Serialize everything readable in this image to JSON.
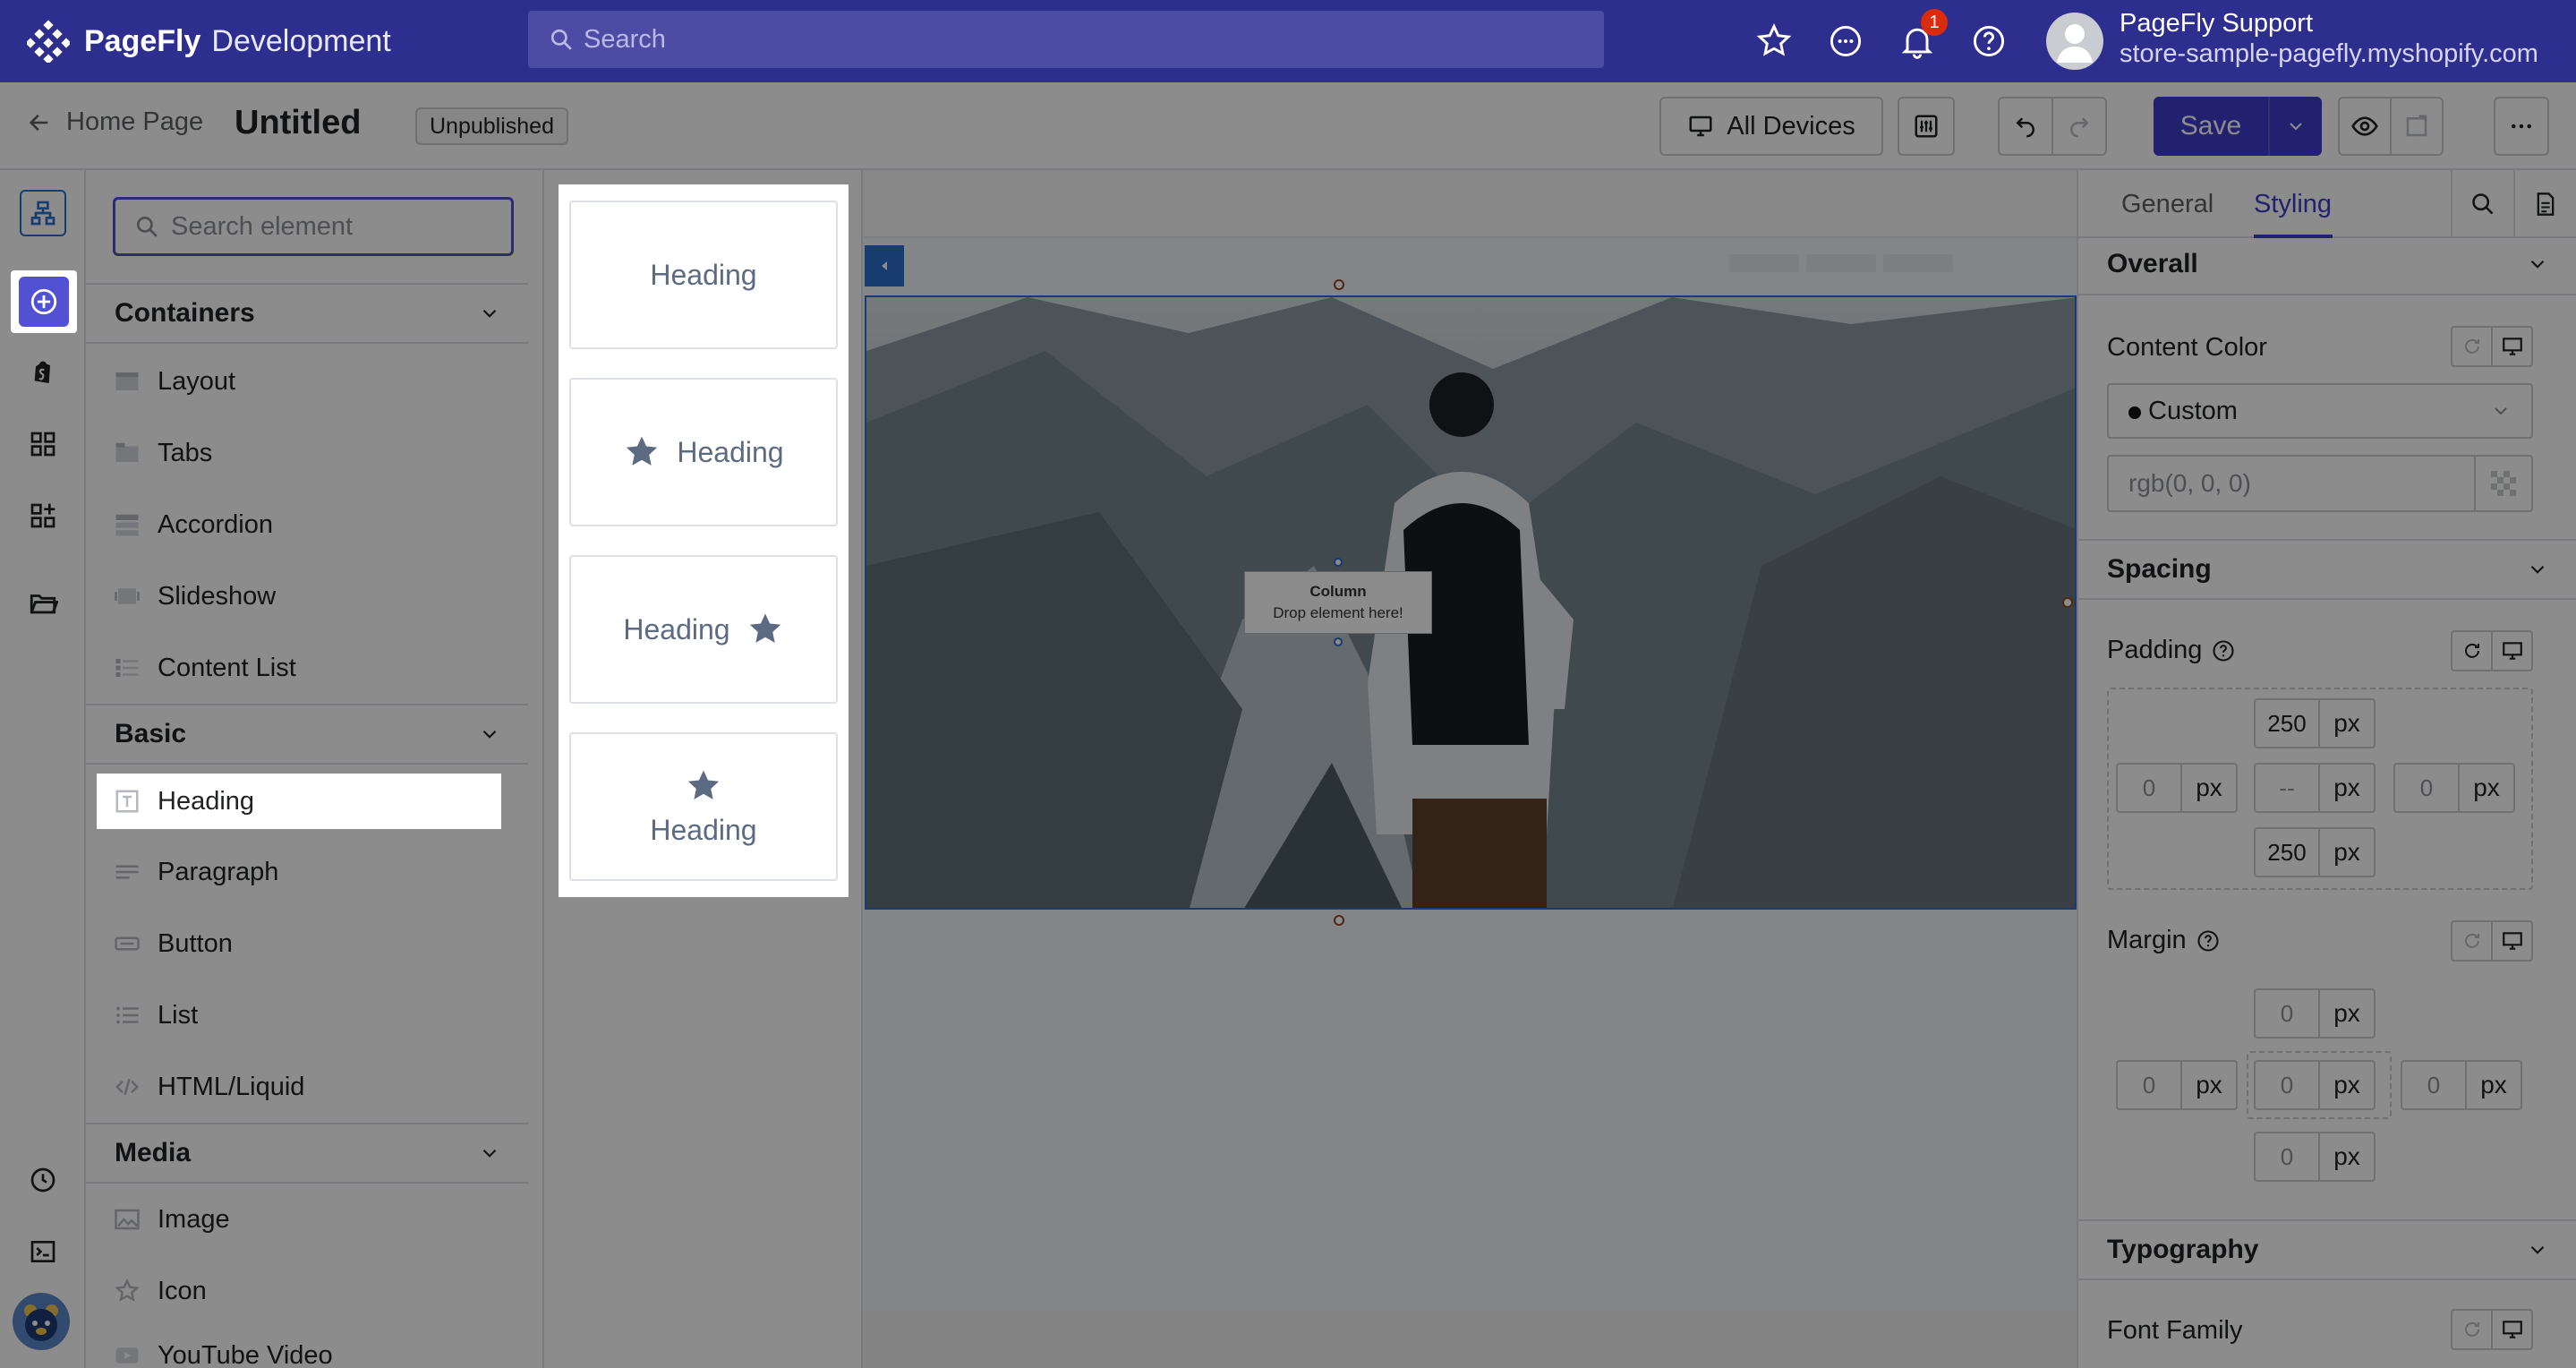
{
  "topbar": {
    "brand_name": "PageFly",
    "brand_sub": "Development",
    "search_placeholder": "Search",
    "notification_count": "1",
    "user_name": "PageFly Support",
    "user_store": "store-sample-pagefly.myshopify.com"
  },
  "header": {
    "back_label": "Home Page",
    "page_title": "Untitled",
    "status_badge": "Unpublished",
    "devices_label": "All Devices",
    "save_label": "Save"
  },
  "element_panel": {
    "search_placeholder": "Search element",
    "sections": [
      {
        "title": "Containers",
        "items": [
          "Layout",
          "Tabs",
          "Accordion",
          "Slideshow",
          "Content List"
        ]
      },
      {
        "title": "Basic",
        "items": [
          "Heading",
          "Paragraph",
          "Button",
          "List",
          "HTML/Liquid"
        ]
      },
      {
        "title": "Media",
        "items": [
          "Image",
          "Icon",
          "YouTube Video"
        ]
      }
    ]
  },
  "variants": [
    "Heading",
    "Heading",
    "Heading",
    "Heading"
  ],
  "canvas": {
    "column_label": "Column",
    "drop_hint": "Drop element here!"
  },
  "right_panel": {
    "tabs": [
      "General",
      "Styling"
    ],
    "active_tab": "Styling",
    "overall": {
      "title": "Overall",
      "content_color_label": "Content Color",
      "color_mode": "Custom",
      "color_value_placeholder": "rgb(0, 0, 0)"
    },
    "spacing": {
      "title": "Spacing",
      "padding_label": "Padding",
      "padding": {
        "top": "250",
        "left": "0",
        "center": "--",
        "right": "0",
        "bottom": "250"
      },
      "margin_label": "Margin",
      "margin": {
        "top": "0",
        "left": "0",
        "center": "0",
        "right": "0",
        "bottom": "0"
      },
      "unit": "px"
    },
    "typography": {
      "title": "Typography",
      "font_family_label": "Font Family"
    }
  },
  "colors": {
    "topbar": "#2e2e8f",
    "accent": "#3c3ccd",
    "selection": "#2c6ecb"
  }
}
